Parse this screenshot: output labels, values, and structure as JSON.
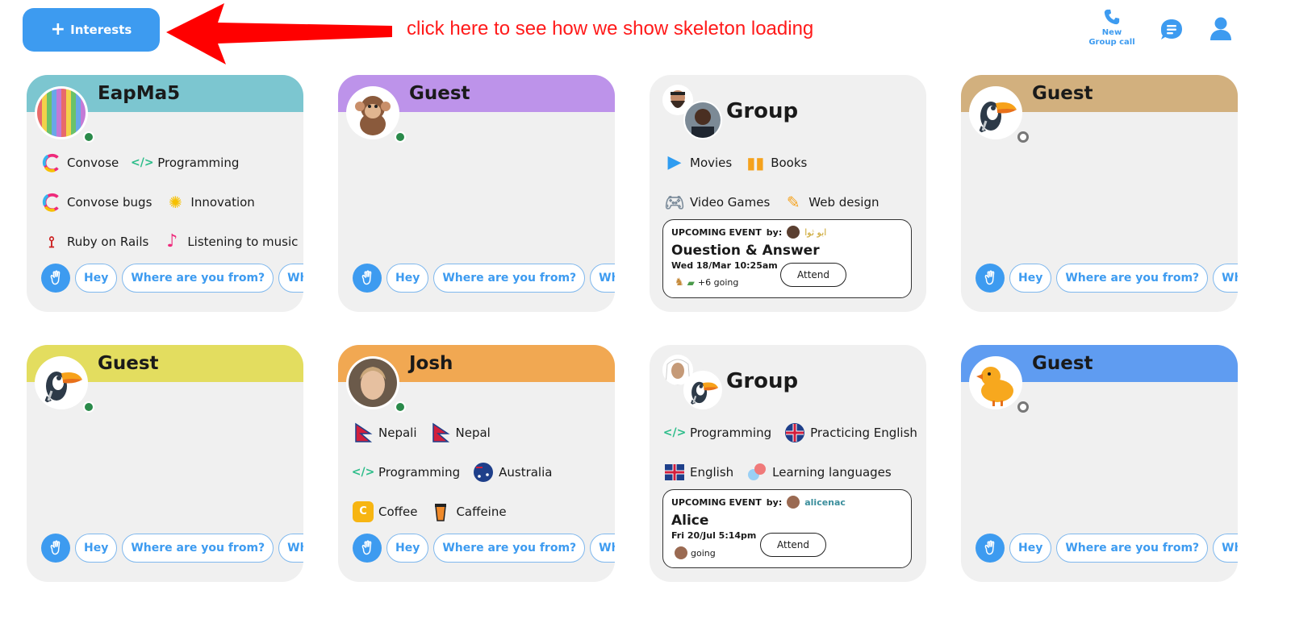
{
  "header": {
    "interests_button": "Interests",
    "annotation": "click here to see how we show skeleton loading",
    "group_call": {
      "line1": "New",
      "line2": "Group call"
    }
  },
  "colors": {
    "accent": "#3d9bf0",
    "annotation": "#ff1a1a",
    "online": "#2a8a4a"
  },
  "chips": [
    "Hey",
    "Where are you from?",
    "What do"
  ],
  "cards": [
    {
      "name": "EapMa5",
      "band": "#7cc6d0",
      "status": "online",
      "tags": [
        [
          "Convose",
          "Programming"
        ],
        [
          "Convose bugs",
          "Innovation"
        ],
        [
          "Ruby on Rails",
          "Listening to music"
        ]
      ]
    },
    {
      "name": "Guest",
      "band": "#bd93ea",
      "status": "online"
    },
    {
      "name": "Group",
      "tags": [
        [
          "Movies",
          "Books"
        ],
        [
          "Video Games",
          "Web design"
        ]
      ],
      "event": {
        "label": "UPCOMING EVENT",
        "by": "by:",
        "host": "ابو ثوا",
        "title": "Ouestion & Answer",
        "date": "Wed 18/Mar 10:25am",
        "going": "+6 going",
        "attend": "Attend"
      }
    },
    {
      "name": "Guest",
      "band": "#d2b07e",
      "status": "offline"
    },
    {
      "name": "Guest",
      "band": "#e3dd5f",
      "status": "online"
    },
    {
      "name": "Josh",
      "band": "#f1a852",
      "status": "online",
      "tags": [
        [
          "Nepali",
          "Nepal"
        ],
        [
          "Programming",
          "Australia"
        ],
        [
          "Coffee",
          "Caffeine"
        ]
      ]
    },
    {
      "name": "Group",
      "tags": [
        [
          "Programming",
          "Practicing English"
        ],
        [
          "English",
          "Learning languages"
        ]
      ],
      "event": {
        "label": "UPCOMING EVENT",
        "by": "by:",
        "host": "alicenac",
        "title": "Alice",
        "date": "Fri 20/Jul 5:14pm",
        "going": "going",
        "attend": "Attend"
      }
    },
    {
      "name": "Guest",
      "band": "#5f9cf1",
      "status": "offline"
    }
  ]
}
